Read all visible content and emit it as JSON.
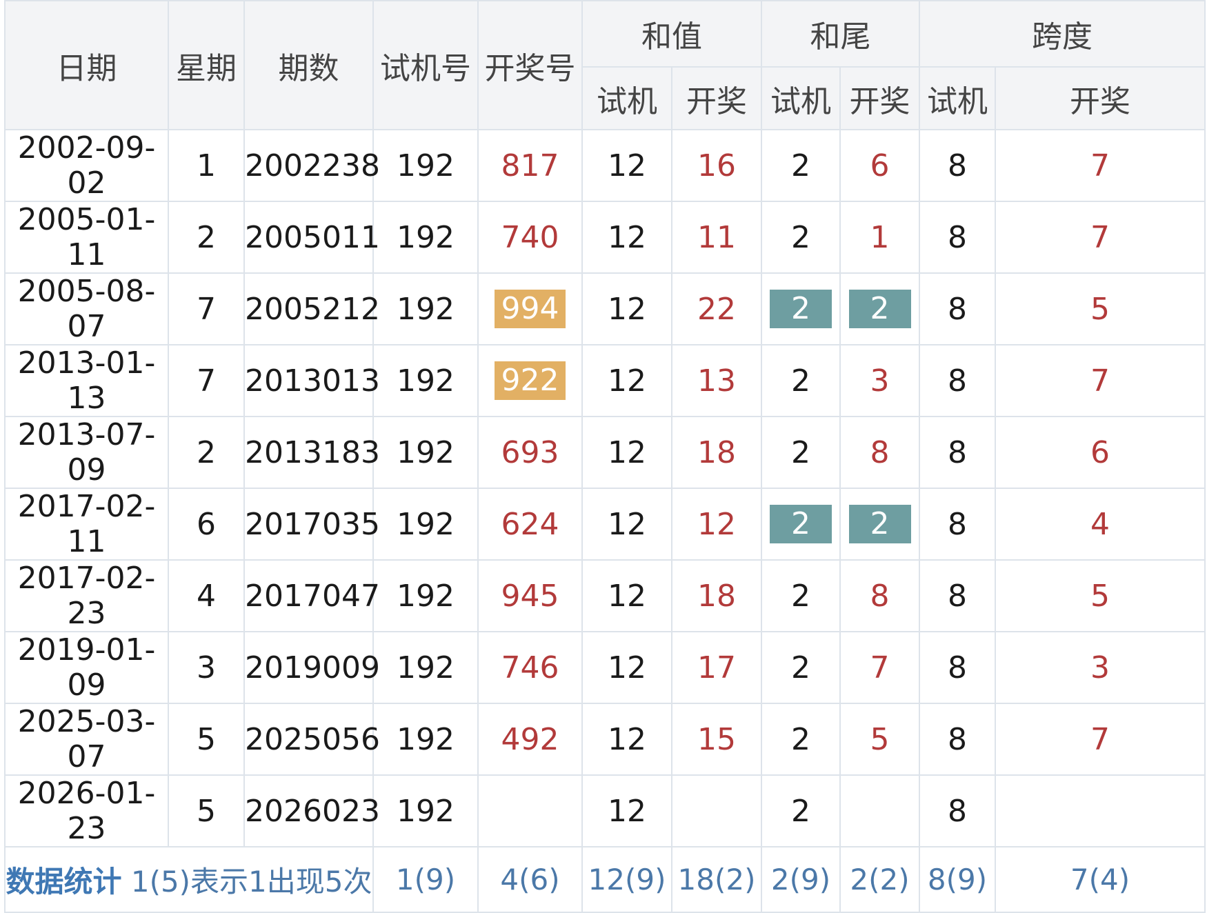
{
  "headers": {
    "date": "日期",
    "weekday": "星期",
    "issue": "期数",
    "trial": "试机号",
    "draw": "开奖号",
    "sum": "和值",
    "sum_tail": "和尾",
    "span": "跨度",
    "sub_trial": "试机",
    "sub_draw": "开奖"
  },
  "rows": [
    {
      "date": "2002-09-02",
      "weekday": "1",
      "issue": "2002238",
      "trial": "192",
      "draw": "817",
      "sum_trial": "12",
      "sum_draw": "16",
      "tail_trial": "2",
      "tail_draw": "6",
      "span_trial": "8",
      "span_draw": "7"
    },
    {
      "date": "2005-01-11",
      "weekday": "2",
      "issue": "2005011",
      "trial": "192",
      "draw": "740",
      "sum_trial": "12",
      "sum_draw": "11",
      "tail_trial": "2",
      "tail_draw": "1",
      "span_trial": "8",
      "span_draw": "7"
    },
    {
      "date": "2005-08-07",
      "weekday": "7",
      "issue": "2005212",
      "trial": "192",
      "draw": "994",
      "sum_trial": "12",
      "sum_draw": "22",
      "tail_trial": "2",
      "tail_draw": "2",
      "span_trial": "8",
      "span_draw": "5"
    },
    {
      "date": "2013-01-13",
      "weekday": "7",
      "issue": "2013013",
      "trial": "192",
      "draw": "922",
      "sum_trial": "12",
      "sum_draw": "13",
      "tail_trial": "2",
      "tail_draw": "3",
      "span_trial": "8",
      "span_draw": "7"
    },
    {
      "date": "2013-07-09",
      "weekday": "2",
      "issue": "2013183",
      "trial": "192",
      "draw": "693",
      "sum_trial": "12",
      "sum_draw": "18",
      "tail_trial": "2",
      "tail_draw": "8",
      "span_trial": "8",
      "span_draw": "6"
    },
    {
      "date": "2017-02-11",
      "weekday": "6",
      "issue": "2017035",
      "trial": "192",
      "draw": "624",
      "sum_trial": "12",
      "sum_draw": "12",
      "tail_trial": "2",
      "tail_draw": "2",
      "span_trial": "8",
      "span_draw": "4"
    },
    {
      "date": "2017-02-23",
      "weekday": "4",
      "issue": "2017047",
      "trial": "192",
      "draw": "945",
      "sum_trial": "12",
      "sum_draw": "18",
      "tail_trial": "2",
      "tail_draw": "8",
      "span_trial": "8",
      "span_draw": "5"
    },
    {
      "date": "2019-01-09",
      "weekday": "3",
      "issue": "2019009",
      "trial": "192",
      "draw": "746",
      "sum_trial": "12",
      "sum_draw": "17",
      "tail_trial": "2",
      "tail_draw": "7",
      "span_trial": "8",
      "span_draw": "3"
    },
    {
      "date": "2025-03-07",
      "weekday": "5",
      "issue": "2025056",
      "trial": "192",
      "draw": "492",
      "sum_trial": "12",
      "sum_draw": "15",
      "tail_trial": "2",
      "tail_draw": "5",
      "span_trial": "8",
      "span_draw": "7"
    },
    {
      "date": "2026-01-23",
      "weekday": "5",
      "issue": "2026023",
      "trial": "192",
      "draw": "",
      "sum_trial": "12",
      "sum_draw": "",
      "tail_trial": "2",
      "tail_draw": "",
      "span_trial": "8",
      "span_draw": ""
    }
  ],
  "stats": {
    "title": "数据统计",
    "note": "1(5)表示1出现5次",
    "trial": "1(9)",
    "draw": "4(6)",
    "sum_trial": "12(9)",
    "sum_draw": "18(2)",
    "tail_trial": "2(9)",
    "tail_draw": "2(2)",
    "span_trial": "8(9)",
    "span_draw": "7(4)"
  }
}
